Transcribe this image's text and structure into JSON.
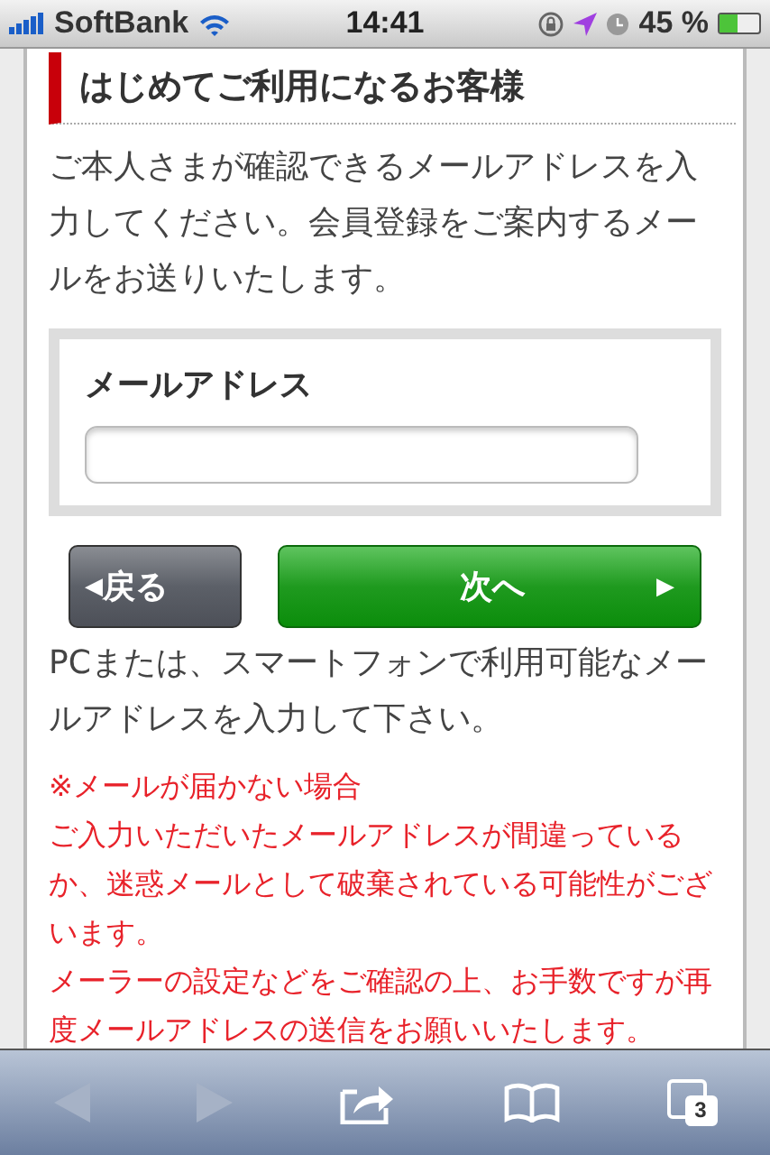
{
  "status_bar": {
    "carrier": "SoftBank",
    "time": "14:41",
    "battery_text": "45 %"
  },
  "heading": "はじめてご利用になるお客様",
  "intro": "ご本人さまが確認できるメールアドレスを入力してください。会員登録をご案内するメールをお送りいたします。",
  "form": {
    "label": "メールアドレス"
  },
  "buttons": [
    {
      "kind": "back",
      "label": "戻る",
      "arrow": "◀"
    },
    {
      "kind": "next",
      "label": "次へ",
      "arrow": "▶"
    }
  ],
  "note": "PCまたは、スマートフォンで利用可能なメールアドレスを入力して下さい。",
  "warning_lines": [
    "※メールが届かない場合",
    "ご入力いただいたメールアドレスが間違っているか、迷惑メールとして破棄されている可能性がございます。",
    "メーラーの設定などをご確認の上、お手数ですが再度メールアドレスの送信をお願いいたします。"
  ],
  "toolbar": {
    "back_disabled": true,
    "forward_disabled": true,
    "tab_count": "3"
  }
}
